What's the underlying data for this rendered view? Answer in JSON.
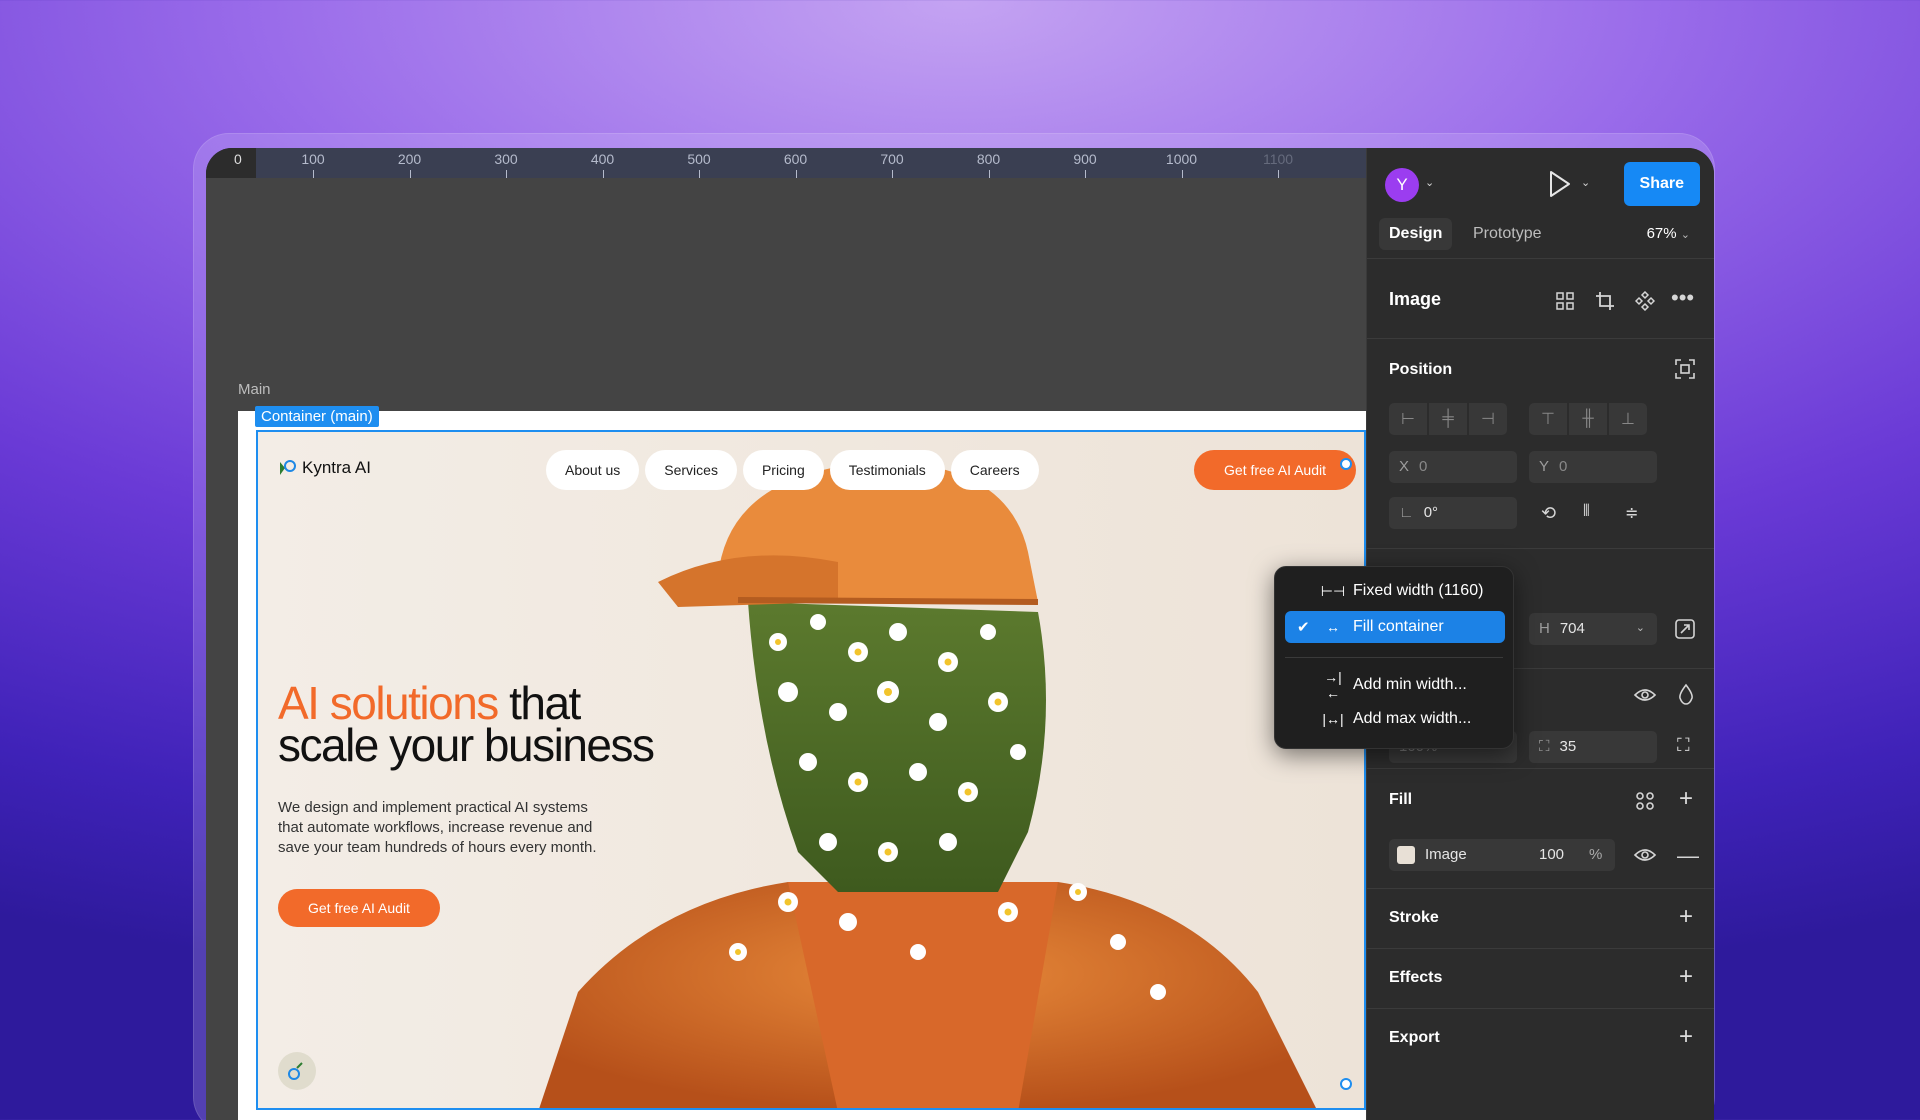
{
  "ruler": {
    "zero": "0",
    "ticks": [
      "100",
      "200",
      "300",
      "400",
      "500",
      "600",
      "700",
      "800",
      "900",
      "1000",
      "1100"
    ]
  },
  "canvas": {
    "frame_label": "Main",
    "container_tag": "Container (main)"
  },
  "site": {
    "brand": "Kyntra AI",
    "nav": [
      "About us",
      "Services",
      "Pricing",
      "Testimonials",
      "Careers"
    ],
    "cta_top": "Get free AI Audit",
    "headline_accent": "AI solutions",
    "headline_rest1": " that",
    "headline_line2": "scale your business",
    "description": "We design and implement practical AI systems that automate workflows, increase revenue and save your team hundreds of hours every month.",
    "cta_main": "Get free AI Audit"
  },
  "panel": {
    "avatar": "Y",
    "share": "Share",
    "tabs": [
      "Design",
      "Prototype"
    ],
    "zoom": "67%",
    "layer_type": "Image",
    "position": {
      "title": "Position",
      "x_label": "X",
      "x_value": "0",
      "y_label": "Y",
      "y_value": "0",
      "rotation": "0°"
    },
    "layout": {
      "h_label": "H",
      "h_value": "704"
    },
    "appearance": {
      "opacity_partial": "100%",
      "radius": "35"
    },
    "fill": {
      "title": "Fill",
      "type": "Image",
      "opacity": "100",
      "unit": "%"
    },
    "sections": [
      "Stroke",
      "Effects",
      "Export"
    ]
  },
  "dropdown": {
    "items": [
      {
        "label": "Fixed width (1160)",
        "selected": false
      },
      {
        "label": "Fill container",
        "selected": true
      },
      {
        "label": "Add min width...",
        "selected": false
      },
      {
        "label": "Add max width...",
        "selected": false
      }
    ]
  },
  "colors": {
    "accent_orange": "#f26a2a",
    "selection_blue": "#1e8ef0",
    "share_blue": "#1689f5",
    "avatar_purple": "#9b3df0"
  }
}
